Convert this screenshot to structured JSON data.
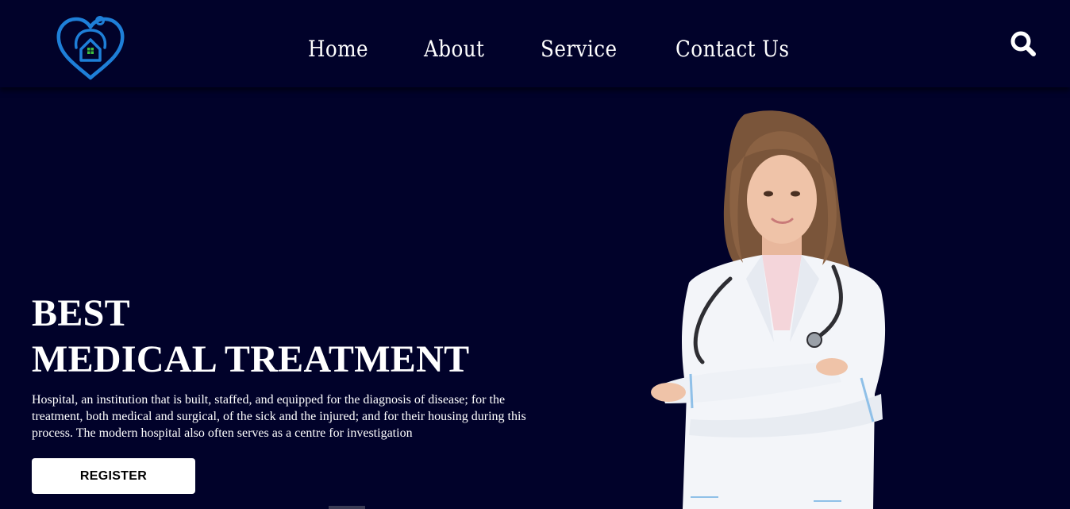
{
  "nav": {
    "links": [
      "Home",
      "About",
      "Service",
      "Contact Us"
    ]
  },
  "icons": {
    "logo": "heart-stethoscope-house-logo",
    "search": "search-icon"
  },
  "hero": {
    "title_line1": "BEST",
    "title_line2": "MEDICAL TREATMENT",
    "description": "Hospital, an institution that is built, staffed, and equipped for the diagnosis of disease; for the treatment, both medical and surgical, of the sick and the injured; and for their housing during this process. The modern hospital also often serves as a centre for investigation",
    "register_label": "REGISTER"
  },
  "colors": {
    "background": "#01022a",
    "logo_blue": "#1e7fd8",
    "logo_green": "#3fbf3f",
    "button_bg": "#ffffff",
    "button_text": "#000000"
  }
}
